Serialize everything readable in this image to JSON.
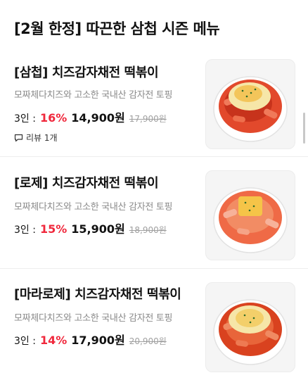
{
  "page": {
    "title": "[2월 한정] 따끈한 삼첩 시즌 메뉴"
  },
  "items": [
    {
      "name": "[삼첩] 치즈감자채전 떡볶이",
      "description": "모짜체다치즈와 고소한 국내산 감자전 토핑",
      "servings": "3인 :",
      "discount": "16%",
      "price": "14,900원",
      "original_price": "17,900원",
      "review": "리뷰 1개",
      "image_icon": "tteokbokki-photo"
    },
    {
      "name": "[로제] 치즈감자채전 떡볶이",
      "description": "모짜체다치즈와 고소한 국내산 감자전 토핑",
      "servings": "3인 :",
      "discount": "15%",
      "price": "15,900원",
      "original_price": "18,900원",
      "image_icon": "tteokbokki-photo"
    },
    {
      "name": "[마라로제] 치즈감자채전 떡볶이",
      "description": "모짜체다치즈와 고소한 국내산 감자전 토핑",
      "servings": "3인 :",
      "discount": "14%",
      "price": "17,900원",
      "original_price": "20,900원",
      "image_icon": "tteokbokki-photo"
    }
  ],
  "colors": {
    "discount": "#f0283c",
    "muted": "#8a8a8a",
    "strike": "#a0a0a0"
  }
}
